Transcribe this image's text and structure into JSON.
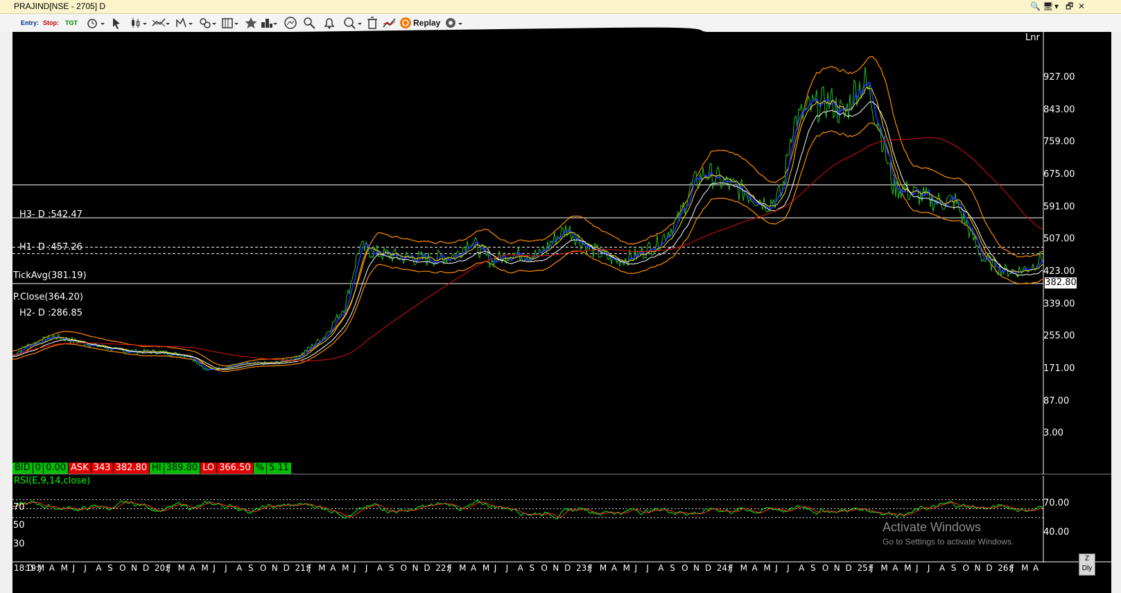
{
  "window": {
    "title": "PRAJIND[NSE - 2705] D",
    "controls": [
      "🔍",
      "🖥",
      "▾",
      "🗗",
      "✕"
    ]
  },
  "toolbar": {
    "entry_label": "Entry:",
    "stop_label": "Stop:",
    "tgt_label": "TGT",
    "replay_label": "Replay",
    "icons": [
      "watch-icon",
      "cursor-icon",
      "candle-icon",
      "line-tools-icon",
      "trend-icon",
      "link-icon",
      "template-icon",
      "star-icon",
      "layout-icon",
      "compare-icon",
      "scan-icon",
      "alert-icon",
      "zoom-icon",
      "delete-icon",
      "drawing-icon",
      "replay-icon",
      "settings-icon"
    ]
  },
  "chart": {
    "scale_label": "Lnr",
    "y_ticks": [
      "927.00",
      "843.00",
      "759.00",
      "675.00",
      "591.00",
      "507.00",
      "423.00",
      "339.00",
      "255.00",
      "171.00",
      "87.00",
      "3.00"
    ],
    "last_price": "382.80",
    "levels": [
      {
        "label": "H3- D :542.47",
        "value": 542.47
      },
      {
        "label": "H1- D :457.26",
        "value": 457.26
      },
      {
        "label": "TickAvg(381.19)",
        "value": 381.19
      },
      {
        "label": "P.Close(364.20)",
        "value": 364.2
      },
      {
        "label": "H2- D :286.85",
        "value": 286.85
      }
    ],
    "colors": {
      "h_line": "#ffffff",
      "tick_avg": "#ffffff",
      "sma_long": "#e01010",
      "ma_blue": "#2030ff",
      "band": "#ff8c00",
      "price": "#22c022",
      "ma_white": "#ffffff"
    }
  },
  "quote": {
    "bid_label": "BID",
    "bid_qty": "0",
    "bid_price": "0.00",
    "ask_label": "ASK",
    "ask_qty": "343",
    "ask_price": "382.80",
    "hi_label": "HI",
    "hi_value": "389.80",
    "lo_label": "LO",
    "lo_value": "366.50",
    "pct_label": "%",
    "pct_value": "5.11"
  },
  "rsi": {
    "name": "RSI(E,9,14,close)",
    "left_labels": [
      "70",
      "50",
      "30"
    ],
    "right_labels": [
      "70.00",
      "40.00"
    ]
  },
  "x_axis": [
    "18:D",
    "19:J",
    "M",
    "A",
    "M",
    "J",
    "J",
    "A",
    "S",
    "O",
    "N",
    "D",
    "20:J",
    "F",
    "M",
    "A",
    "M",
    "J",
    "J",
    "A",
    "S",
    "O",
    "N",
    "D",
    "21:J",
    "F",
    "M",
    "A",
    "M",
    "J",
    "J",
    "A",
    "S",
    "O",
    "N",
    "D",
    "22:J",
    "F",
    "M",
    "A",
    "M",
    "J",
    "J",
    "A",
    "S",
    "O",
    "N",
    "D",
    "23:J",
    "F",
    "M",
    "A",
    "M",
    "J",
    "J",
    "A",
    "S",
    "O",
    "N",
    "D",
    "24:J",
    "F",
    "M",
    "A",
    "M",
    "J",
    "J",
    "A",
    "S",
    "O",
    "N",
    "D",
    "25:J",
    "F",
    "M",
    "A",
    "M",
    "J",
    "J",
    "A",
    "S",
    "O",
    "N",
    "D",
    "26:J",
    "F",
    "M",
    "A"
  ],
  "watermark": {
    "line1": "Activate Windows",
    "line2": "Go to Settings to activate Windows."
  },
  "period_button": {
    "top": "Z",
    "bottom": "Dly"
  }
}
